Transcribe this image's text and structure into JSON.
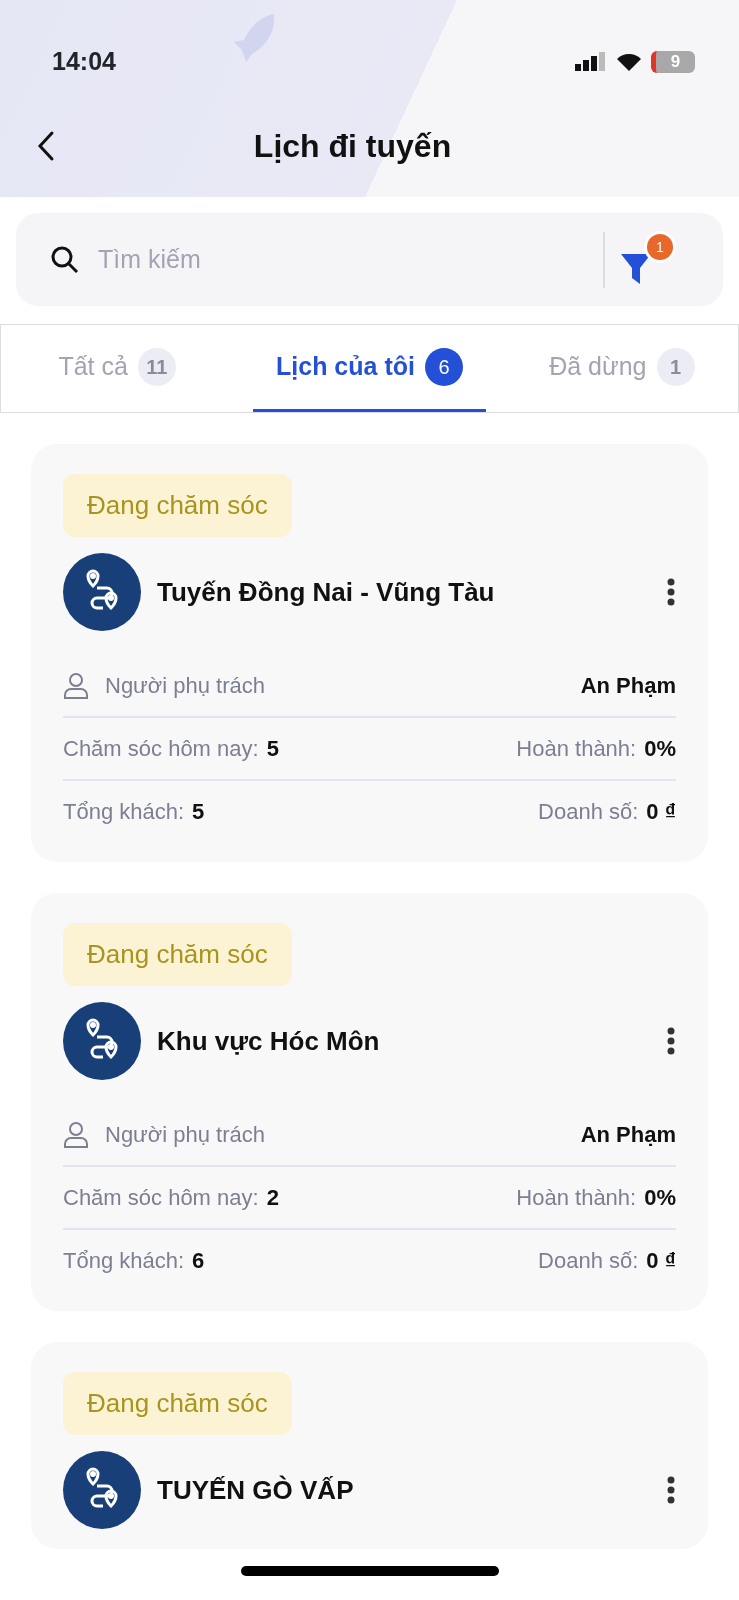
{
  "status_bar": {
    "time": "14:04",
    "battery": "9"
  },
  "header": {
    "title": "Lịch đi tuyến"
  },
  "search": {
    "placeholder": "Tìm kiếm",
    "filter_count": "1"
  },
  "tabs": [
    {
      "label": "Tất cả",
      "count": "11",
      "selected": false
    },
    {
      "label": "Lịch của tôi",
      "count": "6",
      "selected": true
    },
    {
      "label": "Đã dừng",
      "count": "1",
      "selected": false
    }
  ],
  "routes": [
    {
      "status": "Đang chăm sóc",
      "title": "Tuyến Đồng Nai - Vũng Tàu",
      "owner_label": "Người phụ trách",
      "owner": "An Phạm",
      "today_label": "Chăm sóc hôm nay:",
      "today": "5",
      "done_label": "Hoàn thành:",
      "done": "0%",
      "customers_label": "Tổng khách:",
      "customers": "5",
      "revenue_label": "Doanh số:",
      "revenue": "0 ₫"
    },
    {
      "status": "Đang chăm sóc",
      "title": "Khu vực Hóc Môn",
      "owner_label": "Người phụ trách",
      "owner": "An Phạm",
      "today_label": "Chăm sóc hôm nay:",
      "today": "2",
      "done_label": "Hoàn thành:",
      "done": "0%",
      "customers_label": "Tổng khách:",
      "customers": "6",
      "revenue_label": "Doanh số:",
      "revenue": "0 ₫"
    },
    {
      "status": "Đang chăm sóc",
      "title": "TUYẾN GÒ VẤP"
    }
  ]
}
